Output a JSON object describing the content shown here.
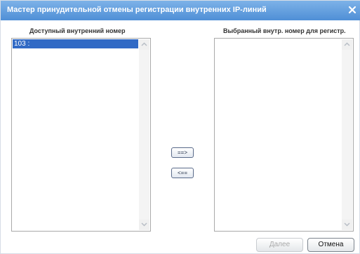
{
  "dialog": {
    "title": "Мастер принудительной отмены регистрации внутренних IP-линий"
  },
  "available": {
    "label": "Доступный внутренний номер",
    "items": [
      "103 :"
    ]
  },
  "selected": {
    "label": "Выбранный внутр. номер для регистр.",
    "items": []
  },
  "controls": {
    "add_label": "==>",
    "remove_label": "<=="
  },
  "footer": {
    "next_label": "Далее",
    "cancel_label": "Отмена"
  },
  "colors": {
    "titlebar": "#5a97dc",
    "selection": "#316ac5"
  }
}
